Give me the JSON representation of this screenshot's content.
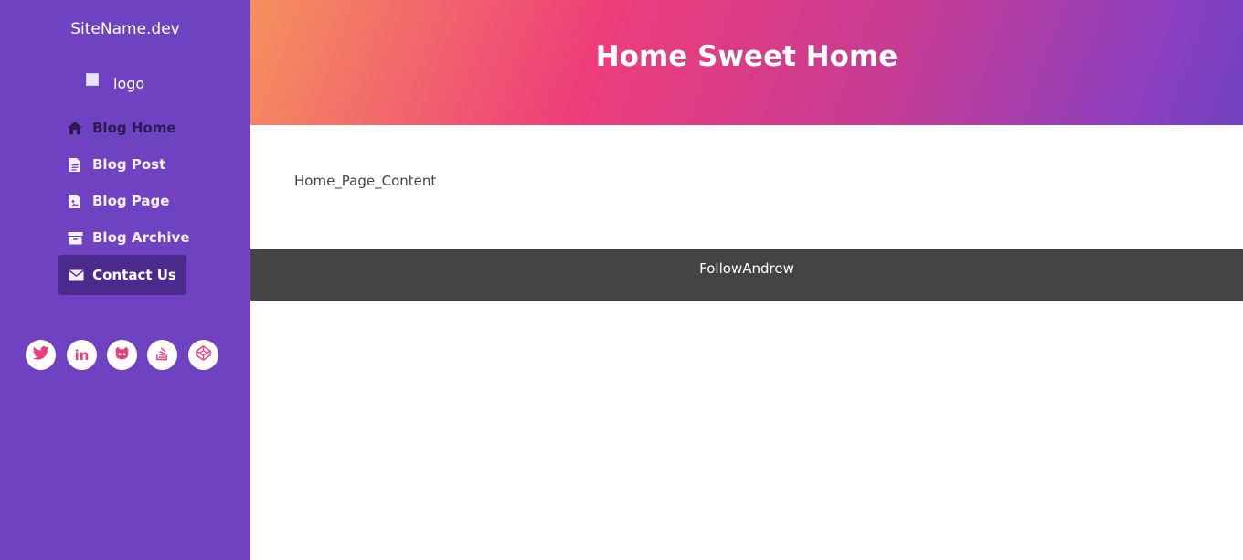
{
  "sidebar": {
    "site_name": "SiteName.dev",
    "logo_alt": "logo",
    "nav": [
      {
        "label": "Blog Home",
        "icon": "home-icon"
      },
      {
        "label": "Blog Post",
        "icon": "document-icon"
      },
      {
        "label": "Blog Page",
        "icon": "file-image-icon"
      },
      {
        "label": "Blog Archive",
        "icon": "archive-icon"
      },
      {
        "label": "Contact Us",
        "icon": "envelope-icon"
      }
    ],
    "social": [
      "twitter-icon",
      "linkedin-icon",
      "github-icon",
      "stackoverflow-icon",
      "codepen-icon"
    ]
  },
  "header": {
    "title": "Home Sweet Home"
  },
  "main": {
    "content": "Home_Page_Content"
  },
  "footer": {
    "label": "FollowAndrew"
  },
  "colors": {
    "sidebar_bg": "#6f42c1",
    "active_nav_bg": "#4a2a8a",
    "social_icon": "#ee3d7a",
    "footer_bg": "#444444"
  }
}
